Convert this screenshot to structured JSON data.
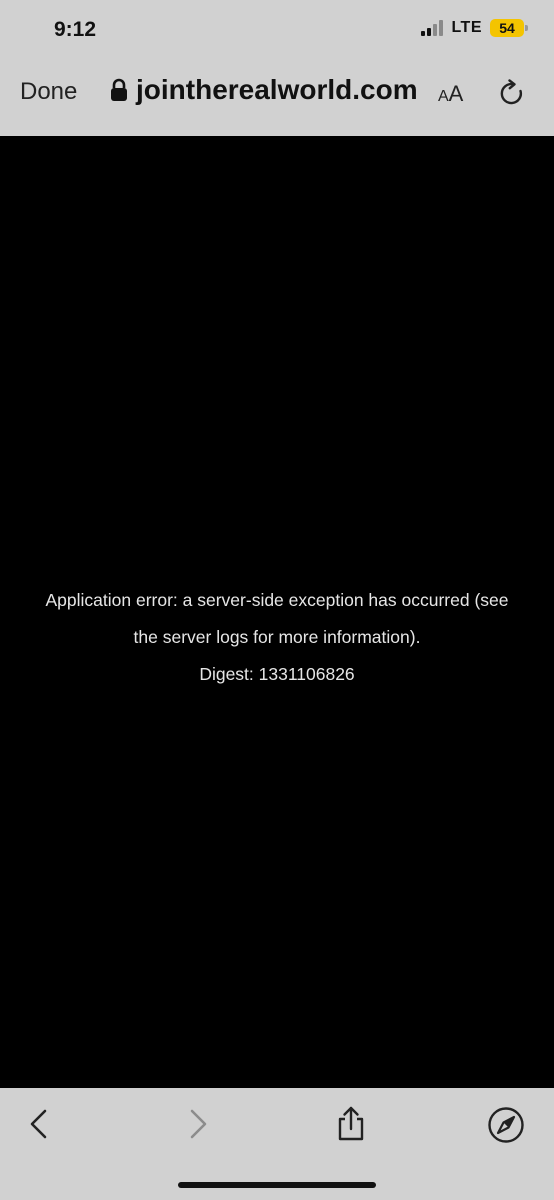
{
  "status": {
    "time": "9:12",
    "network": "LTE",
    "battery": "54"
  },
  "browser": {
    "done_label": "Done",
    "domain": "jointherealworld.com",
    "reader_label_big": "A",
    "reader_label_small": "A"
  },
  "page": {
    "error_line1": "Application error: a server-side exception has occurred (see",
    "error_line2": "the server logs for more information).",
    "digest": "Digest: 1331106826"
  },
  "colors": {
    "bar": "#d1d1d1",
    "battery": "#f4c400",
    "content_bg": "#000000"
  },
  "icons": {
    "lock": "lock-icon",
    "reload": "reload-icon",
    "back": "chevron-left-icon",
    "forward": "chevron-right-icon",
    "share": "share-icon",
    "safari": "compass-icon"
  }
}
